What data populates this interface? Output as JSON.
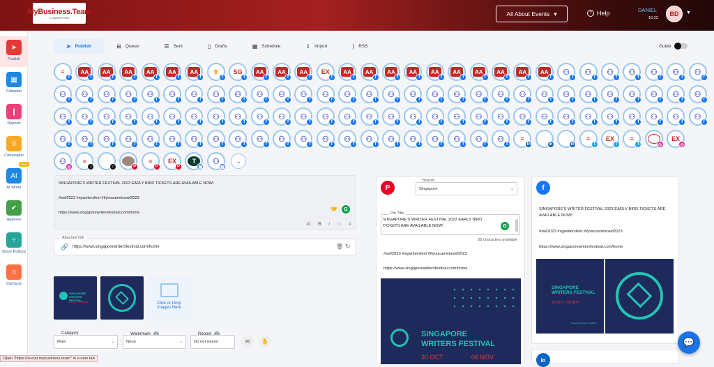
{
  "header": {
    "logo_text": "MyBusiness.Team",
    "logo_sub": "CI MARKETING",
    "events_label": "All About Events",
    "help_label": "Help",
    "user_name": "DANIEL",
    "user_time": "16:22",
    "avatar_initials": "BD"
  },
  "sidebar": {
    "items": [
      {
        "label": "Publish",
        "icon": "paper-plane-icon",
        "color": "#e53935"
      },
      {
        "label": "Calendar",
        "icon": "calendar-icon",
        "color": "#1e88e5"
      },
      {
        "label": "Reports",
        "icon": "bar-chart-icon",
        "color": "#ec407a"
      },
      {
        "label": "Campaigns",
        "icon": "trophy-icon",
        "color": "#f9a825"
      },
      {
        "label": "AI Writer",
        "icon": "ai-icon",
        "color": "#1e88e5"
      },
      {
        "label": "Approve",
        "icon": "image-check-icon",
        "color": "#43a047"
      },
      {
        "label": "Share Buttons",
        "icon": "share-icon",
        "color": "#26a69a"
      },
      {
        "label": "Contacts",
        "icon": "contacts-icon",
        "color": "#ff7043"
      }
    ],
    "new_badge": "New"
  },
  "tabs": [
    {
      "label": "Publish",
      "icon": "paper-plane-icon"
    },
    {
      "label": "Queue",
      "icon": "plus-square-icon"
    },
    {
      "label": "Sent",
      "icon": "list-icon"
    },
    {
      "label": "Drafts",
      "icon": "file-icon"
    },
    {
      "label": "Schedule",
      "icon": "calendar-icon"
    },
    {
      "label": "Import",
      "icon": "import-icon"
    },
    {
      "label": "RSS",
      "icon": "rss-icon"
    }
  ],
  "guide_label": "Guide",
  "accounts": {
    "row1": [
      "MBT",
      "AA",
      "AA",
      "AA",
      "AA",
      "AA",
      "AA",
      "GOLD",
      "SG",
      "AA",
      "AA",
      "AA",
      "EX",
      "AA",
      "AA",
      "AA",
      "AA",
      "AA",
      "AA",
      "AA",
      "AA",
      "AA",
      "AA",
      "AA",
      "AA",
      "AA",
      "AA",
      "AA",
      "AA",
      "AA"
    ],
    "row1_brands": [
      "logo",
      "aa",
      "aa",
      "aa",
      "aa",
      "aa",
      "aa",
      "gold",
      "sg",
      "aa",
      "aa",
      "aa",
      "ex",
      "aa",
      "aa",
      "aa",
      "aa",
      "aa",
      "aa",
      "aa",
      "aa",
      "aa",
      "aa",
      "mbt",
      "mbt",
      "mbt",
      "mbt",
      "mbt",
      "mbt",
      "mbt"
    ],
    "row4_brands": [
      "mbt",
      "mbt",
      "mbt",
      "mbt",
      "mbt",
      "mbt",
      "mbt",
      "mbt",
      "mbt",
      "mbt",
      "mbt",
      "mbt",
      "mbt",
      "mbt",
      "mbt",
      "mbt",
      "mbt",
      "mbt",
      "mbt",
      "mbt",
      "mbt",
      "logo",
      "blank",
      "blank",
      "logo",
      "ex",
      "logo",
      "round",
      "ex"
    ],
    "row4_networks": [
      "fb",
      "fb",
      "fb",
      "fb",
      "fb",
      "fb",
      "fb",
      "fb",
      "fb",
      "fb",
      "fb",
      "fb",
      "fb",
      "fb",
      "fb",
      "fb",
      "fb",
      "fb",
      "fb",
      "fb",
      "fb",
      "li",
      "li",
      "li",
      "tw",
      "tw",
      "tw",
      "ig",
      "ig"
    ],
    "row5": [
      "mbt-ig",
      "logo-tt",
      "blank-tt",
      "photo-pi",
      "logo-pi",
      "ex-pi",
      "t-gb",
      "mbt-gb"
    ]
  },
  "composer": {
    "line1": "SINGAPORE'S WRITER FESTIVAL 2023 EARLY BIRD TICKETS ARE AVAILABLE NOW!",
    "line2": "#swf2023 #sgwritersfest #ifyoucametoswf2023",
    "line3": "https://www.singaporewritersfestival.com/home",
    "grammarly": "G"
  },
  "attached_link": {
    "label": "Attached link",
    "value": "https://www.singaporewritersfestival.com/home"
  },
  "media": {
    "drop_label": "Click or Drop Images Here",
    "thumb_title": "SINGAPORE WRITERS FESTIVAL",
    "thumb_dates": "30 OCT • 08 NOV"
  },
  "options": {
    "category_label": "Category",
    "category_value": "Main",
    "watermark_label": "Watermark",
    "watermark_value": "None",
    "repost_label": "Repost",
    "repost_value": "Do not repost"
  },
  "pinterest_preview": {
    "boards_label": "Boards",
    "boards_value": "Singapore",
    "pin_title_label": "Pin Title",
    "pin_title_value": "SINGAPORE'S WRITER FESTIVAL 2023 EARLY BIRD TICKETS ARE AVAILABLE NOW!",
    "chars": "29 characters available",
    "hashtags": "#swf2023 #sgwritersfest #ifyoucametoswf2023",
    "link": "https://www.singaporewritersfestival.com/home",
    "image_title_1": "SINGAPORE",
    "image_title_2": "WRITERS FESTIVAL",
    "image_date_1": "30 OCT",
    "image_date_2": "08 NOV"
  },
  "facebook_preview": {
    "line1": "SINGAPORE'S WRITER FESTIVAL 2023 EARLY BIRD TICKETS ARE AVAILABLE NOW!",
    "line2": "#swf2023 #sgwritersfest #ifyoucametoswf2023",
    "line3": "https://www.singaporewritersfestival.com/home",
    "image_title": "SINGAPORE WRITERS FESTIVAL",
    "image_dates": "30 OCT • 08 NOV",
    "image_foot": "SingaporeWriters Fest2023"
  },
  "status_bar": "Open \"https://social.mybusiness.team\" in a new tab",
  "colors": {
    "brand_red": "#b71c1c",
    "accent_blue": "#1a73e8",
    "facebook": "#1877f2",
    "pinterest": "#e60023",
    "linkedin": "#0a66c2",
    "twitter": "#1da1f2",
    "instagram": "#d6249f",
    "festival_navy": "#1f2a5c",
    "festival_teal": "#20c4b4"
  }
}
